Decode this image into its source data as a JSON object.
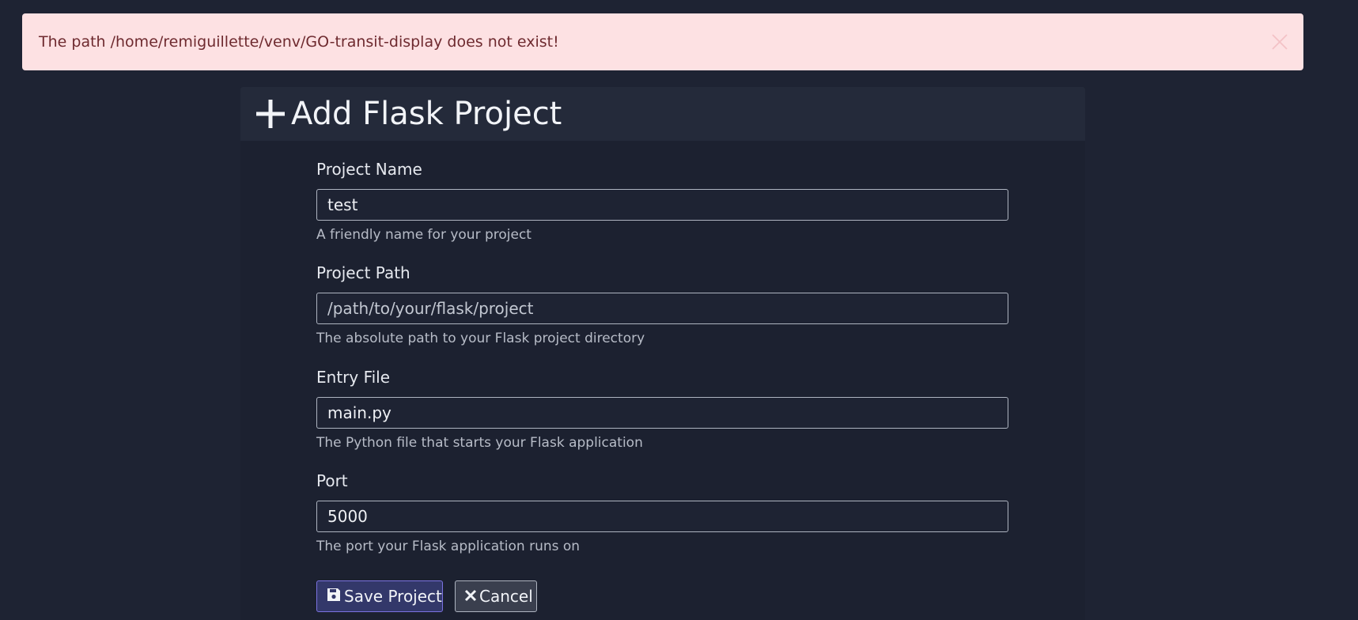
{
  "alert": {
    "message": "The path /home/remiguillette/venv/GO-transit-display does not exist!",
    "close_icon": "close-icon"
  },
  "page": {
    "title": "Add Flask Project",
    "title_icon": "plus-icon"
  },
  "form": {
    "project_name": {
      "label": "Project Name",
      "value": "test",
      "help": "A friendly name for your project"
    },
    "project_path": {
      "label": "Project Path",
      "value": "",
      "placeholder": "/path/to/your/flask/project",
      "help": "The absolute path to your Flask project directory"
    },
    "entry_file": {
      "label": "Entry File",
      "value": "main.py",
      "help": "The Python file that starts your Flask application"
    },
    "port": {
      "label": "Port",
      "value": "5000",
      "help": "The port your Flask application runs on"
    }
  },
  "actions": {
    "save_label": "Save Project",
    "save_icon": "floppy-disk-icon",
    "cancel_label": "Cancel",
    "cancel_icon": "x-icon"
  },
  "colors": {
    "background": "#1e2333",
    "alert_bg": "#fde1e3",
    "alert_text": "#6e2a2f",
    "save_border": "#7b72e0"
  }
}
